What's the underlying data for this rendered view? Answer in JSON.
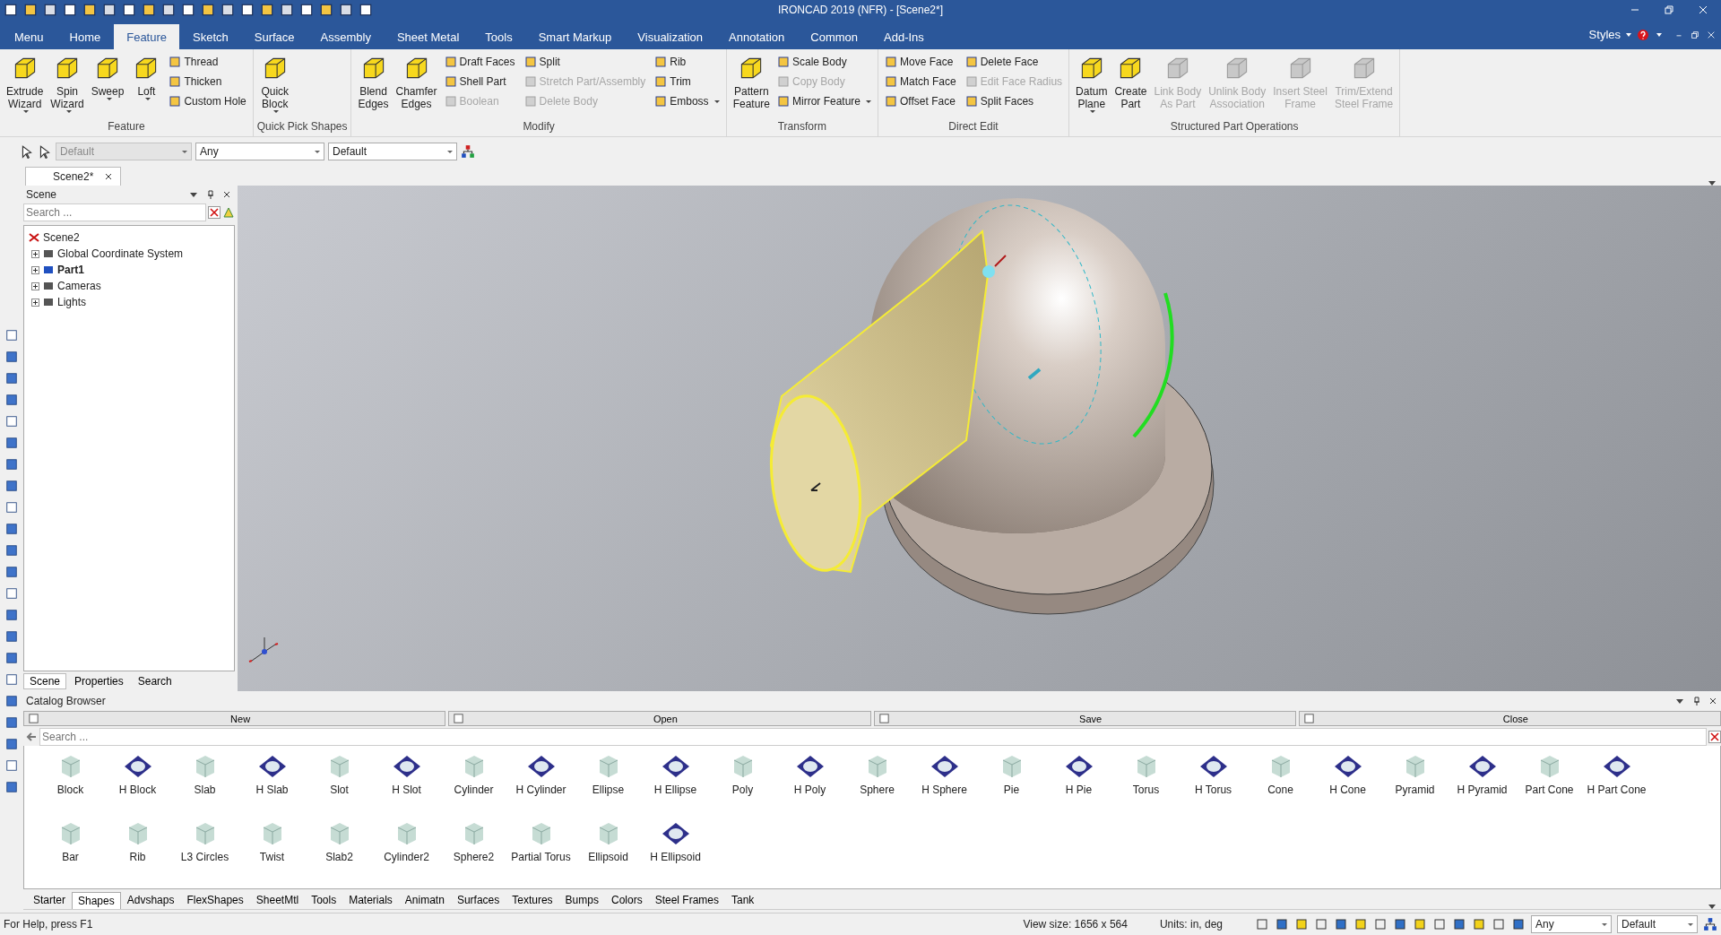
{
  "window": {
    "title": "IRONCAD 2019 (NFR) - [Scene2*]"
  },
  "menu_tabs": [
    {
      "label": "Menu",
      "selected": false
    },
    {
      "label": "Home",
      "selected": false
    },
    {
      "label": "Feature",
      "selected": true
    },
    {
      "label": "Sketch",
      "selected": false
    },
    {
      "label": "Surface",
      "selected": false
    },
    {
      "label": "Assembly",
      "selected": false
    },
    {
      "label": "Sheet Metal",
      "selected": false
    },
    {
      "label": "Tools",
      "selected": false
    },
    {
      "label": "Smart Markup",
      "selected": false
    },
    {
      "label": "Visualization",
      "selected": false
    },
    {
      "label": "Annotation",
      "selected": false
    },
    {
      "label": "Common",
      "selected": false
    },
    {
      "label": "Add-Ins",
      "selected": false
    }
  ],
  "styles_menu": {
    "label": "Styles"
  },
  "ribbon": [
    {
      "label": "Feature",
      "items": [
        {
          "kind": "large",
          "label": "Extrude\nWizard",
          "disabled": false,
          "dropdown": true
        },
        {
          "kind": "large",
          "label": "Spin\nWizard",
          "disabled": false,
          "dropdown": true
        },
        {
          "kind": "large",
          "label": "Sweep",
          "disabled": false,
          "dropdown": true
        },
        {
          "kind": "large",
          "label": "Loft",
          "disabled": false,
          "dropdown": true
        },
        {
          "kind": "small",
          "label": "Thread",
          "disabled": false,
          "dropdown": false
        },
        {
          "kind": "small",
          "label": "Thicken",
          "disabled": false,
          "dropdown": false
        },
        {
          "kind": "small",
          "label": "Custom Hole",
          "disabled": false,
          "dropdown": false
        }
      ]
    },
    {
      "label": "Quick Pick Shapes",
      "items": [
        {
          "kind": "large",
          "label": "Quick\nBlock",
          "disabled": false,
          "dropdown": true
        }
      ]
    },
    {
      "label": "Modify",
      "items": [
        {
          "kind": "large",
          "label": "Blend\nEdges",
          "disabled": false,
          "dropdown": false
        },
        {
          "kind": "large",
          "label": "Chamfer\nEdges",
          "disabled": false,
          "dropdown": false
        },
        {
          "kind": "small",
          "label": "Draft Faces",
          "disabled": false,
          "dropdown": false
        },
        {
          "kind": "small",
          "label": "Shell Part",
          "disabled": false,
          "dropdown": false
        },
        {
          "kind": "small",
          "label": "Boolean",
          "disabled": true,
          "dropdown": false
        },
        {
          "kind": "small",
          "label": "Split",
          "disabled": false,
          "dropdown": false
        },
        {
          "kind": "small",
          "label": "Stretch Part/Assembly",
          "disabled": true,
          "dropdown": false
        },
        {
          "kind": "small",
          "label": "Delete Body",
          "disabled": true,
          "dropdown": false
        },
        {
          "kind": "small",
          "label": "Rib",
          "disabled": false,
          "dropdown": false
        },
        {
          "kind": "small",
          "label": "Trim",
          "disabled": false,
          "dropdown": false
        },
        {
          "kind": "small",
          "label": "Emboss",
          "disabled": false,
          "dropdown": true
        }
      ]
    },
    {
      "label": "Transform",
      "items": [
        {
          "kind": "large",
          "label": "Pattern\nFeature",
          "disabled": false,
          "dropdown": false
        },
        {
          "kind": "small",
          "label": "Scale Body",
          "disabled": false,
          "dropdown": false
        },
        {
          "kind": "small",
          "label": "Copy Body",
          "disabled": true,
          "dropdown": false
        },
        {
          "kind": "small",
          "label": "Mirror Feature",
          "disabled": false,
          "dropdown": true
        }
      ]
    },
    {
      "label": "Direct Edit",
      "items": [
        {
          "kind": "small",
          "label": "Move Face",
          "disabled": false,
          "dropdown": false
        },
        {
          "kind": "small",
          "label": "Match Face",
          "disabled": false,
          "dropdown": false
        },
        {
          "kind": "small",
          "label": "Offset Face",
          "disabled": false,
          "dropdown": false
        },
        {
          "kind": "small",
          "label": "Delete Face",
          "disabled": false,
          "dropdown": false
        },
        {
          "kind": "small",
          "label": "Edit Face Radius",
          "disabled": true,
          "dropdown": false
        },
        {
          "kind": "small",
          "label": "Split Faces",
          "disabled": false,
          "dropdown": false
        }
      ]
    },
    {
      "label": "Structured Part Operations",
      "items": [
        {
          "kind": "large",
          "label": "Datum\nPlane",
          "disabled": false,
          "dropdown": true
        },
        {
          "kind": "large",
          "label": "Create\nPart",
          "disabled": false,
          "dropdown": false
        },
        {
          "kind": "large",
          "label": "Link Body\nAs Part",
          "disabled": true,
          "dropdown": false
        },
        {
          "kind": "large",
          "label": "Unlink Body\nAssociation",
          "disabled": true,
          "dropdown": false
        },
        {
          "kind": "large",
          "label": "Insert Steel\nFrame",
          "disabled": true,
          "dropdown": false
        },
        {
          "kind": "large",
          "label": "Trim/Extend\nSteel Frame",
          "disabled": true,
          "dropdown": false
        }
      ]
    }
  ],
  "toolbar": {
    "selectors": [
      {
        "value": "Default",
        "disabled": true
      },
      {
        "value": "Any",
        "disabled": false
      },
      {
        "value": "Default",
        "disabled": false
      }
    ]
  },
  "document_tabs": [
    {
      "label": "Scene2*",
      "selected": true
    }
  ],
  "scene_panel": {
    "title": "Scene",
    "search": {
      "placeholder": "Search ..."
    },
    "tree": {
      "label": "Scene2",
      "children": [
        {
          "label": "Global Coordinate System",
          "active": false,
          "expanded": false
        },
        {
          "label": "Part1",
          "active": true,
          "expanded": false
        },
        {
          "label": "Cameras",
          "active": false,
          "expanded": false
        },
        {
          "label": "Lights",
          "active": false,
          "expanded": false
        }
      ]
    },
    "tabs": [
      {
        "label": "Scene",
        "selected": true
      },
      {
        "label": "Properties",
        "selected": false
      },
      {
        "label": "Search",
        "selected": false
      }
    ]
  },
  "catalog": {
    "title": "Catalog Browser",
    "buttons": [
      "New",
      "Open",
      "Save",
      "Close"
    ],
    "search": {
      "placeholder": "Search ..."
    },
    "items": [
      {
        "label": "Block",
        "kind": "solid"
      },
      {
        "label": "H Block",
        "kind": "hollow"
      },
      {
        "label": "Slab",
        "kind": "solid"
      },
      {
        "label": "H Slab",
        "kind": "hollow"
      },
      {
        "label": "Slot",
        "kind": "solid"
      },
      {
        "label": "H Slot",
        "kind": "hollow"
      },
      {
        "label": "Cylinder",
        "kind": "solid"
      },
      {
        "label": "H Cylinder",
        "kind": "hollow"
      },
      {
        "label": "Ellipse",
        "kind": "solid"
      },
      {
        "label": "H Ellipse",
        "kind": "hollow"
      },
      {
        "label": "Poly",
        "kind": "solid"
      },
      {
        "label": "H Poly",
        "kind": "hollow"
      },
      {
        "label": "Sphere",
        "kind": "solid"
      },
      {
        "label": "H Sphere",
        "kind": "hollow"
      },
      {
        "label": "Pie",
        "kind": "solid"
      },
      {
        "label": "H Pie",
        "kind": "hollow"
      },
      {
        "label": "Torus",
        "kind": "solid"
      },
      {
        "label": "H Torus",
        "kind": "hollow"
      },
      {
        "label": "Cone",
        "kind": "solid"
      },
      {
        "label": "H Cone",
        "kind": "hollow"
      },
      {
        "label": "Pyramid",
        "kind": "solid"
      },
      {
        "label": "H Pyramid",
        "kind": "hollow"
      },
      {
        "label": "Part Cone",
        "kind": "solid"
      },
      {
        "label": "H Part Cone",
        "kind": "hollow"
      },
      {
        "label": "Bar",
        "kind": "solid"
      },
      {
        "label": "Rib",
        "kind": "solid"
      },
      {
        "label": "L3 Circles",
        "kind": "solid"
      },
      {
        "label": "Twist",
        "kind": "solid"
      },
      {
        "label": "Slab2",
        "kind": "solid"
      },
      {
        "label": "Cylinder2",
        "kind": "solid"
      },
      {
        "label": "Sphere2",
        "kind": "solid"
      },
      {
        "label": "Partial Torus",
        "kind": "solid"
      },
      {
        "label": "Ellipsoid",
        "kind": "solid"
      },
      {
        "label": "H Ellipsoid",
        "kind": "hollow"
      }
    ],
    "tabs": [
      {
        "label": "Starter",
        "selected": false
      },
      {
        "label": "Shapes",
        "selected": true
      },
      {
        "label": "Advshaps",
        "selected": false
      },
      {
        "label": "FlexShapes",
        "selected": false
      },
      {
        "label": "SheetMtl",
        "selected": false
      },
      {
        "label": "Tools",
        "selected": false
      },
      {
        "label": "Materials",
        "selected": false
      },
      {
        "label": "Animatn",
        "selected": false
      },
      {
        "label": "Surfaces",
        "selected": false
      },
      {
        "label": "Textures",
        "selected": false
      },
      {
        "label": "Bumps",
        "selected": false
      },
      {
        "label": "Colors",
        "selected": false
      },
      {
        "label": "Steel Frames",
        "selected": false
      },
      {
        "label": "Tank",
        "selected": false
      }
    ]
  },
  "status_bar": {
    "help": "For Help, press F1",
    "view_size": "View size: 1656 x  564",
    "units": "Units: in, deg",
    "selectors": [
      "Any",
      "Default"
    ]
  }
}
